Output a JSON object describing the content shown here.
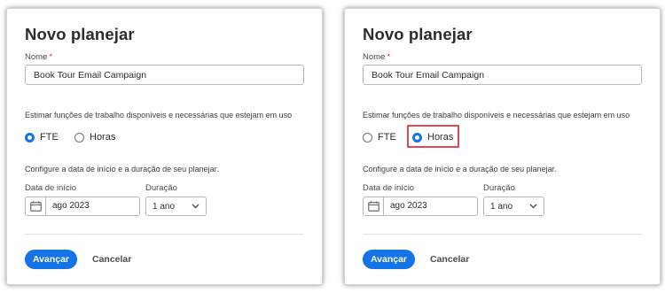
{
  "panels": [
    {
      "title": "Novo planejar",
      "name_label": "Nome",
      "required_mark": "*",
      "name_value": "Book Tour Email Campaign",
      "estimate_text": "Estimar funções de trabalho disponíveis e necessárias que estejam em uso",
      "option_fte": "FTE",
      "option_hours": "Horas",
      "selected_option": "FTE",
      "configure_text": "Configure a data de início e a duração de seu planejar.",
      "start_label": "Data de início",
      "start_value": "ago 2023",
      "duration_label": "Duração",
      "duration_value": "1 ano",
      "next_button": "Avançar",
      "cancel_button": "Cancelar"
    },
    {
      "title": "Novo planejar",
      "name_label": "Nome",
      "required_mark": "*",
      "name_value": "Book Tour Email Campaign",
      "estimate_text": "Estimar funções de trabalho disponíveis e necessárias que estejam em uso",
      "option_fte": "FTE",
      "option_hours": "Horas",
      "selected_option": "Horas",
      "configure_text": "Configure a data de início e a duração de seu planejar.",
      "start_label": "Data de início",
      "start_value": "ago 2023",
      "duration_label": "Duração",
      "duration_value": "1 ano",
      "next_button": "Avançar",
      "cancel_button": "Cancelar"
    }
  ],
  "colors": {
    "accent": "#1473e6",
    "highlight": "#e34850",
    "required": "#d7373f"
  },
  "icons": {
    "calendar": "calendar-icon",
    "chevron": "chevron-down-icon"
  }
}
